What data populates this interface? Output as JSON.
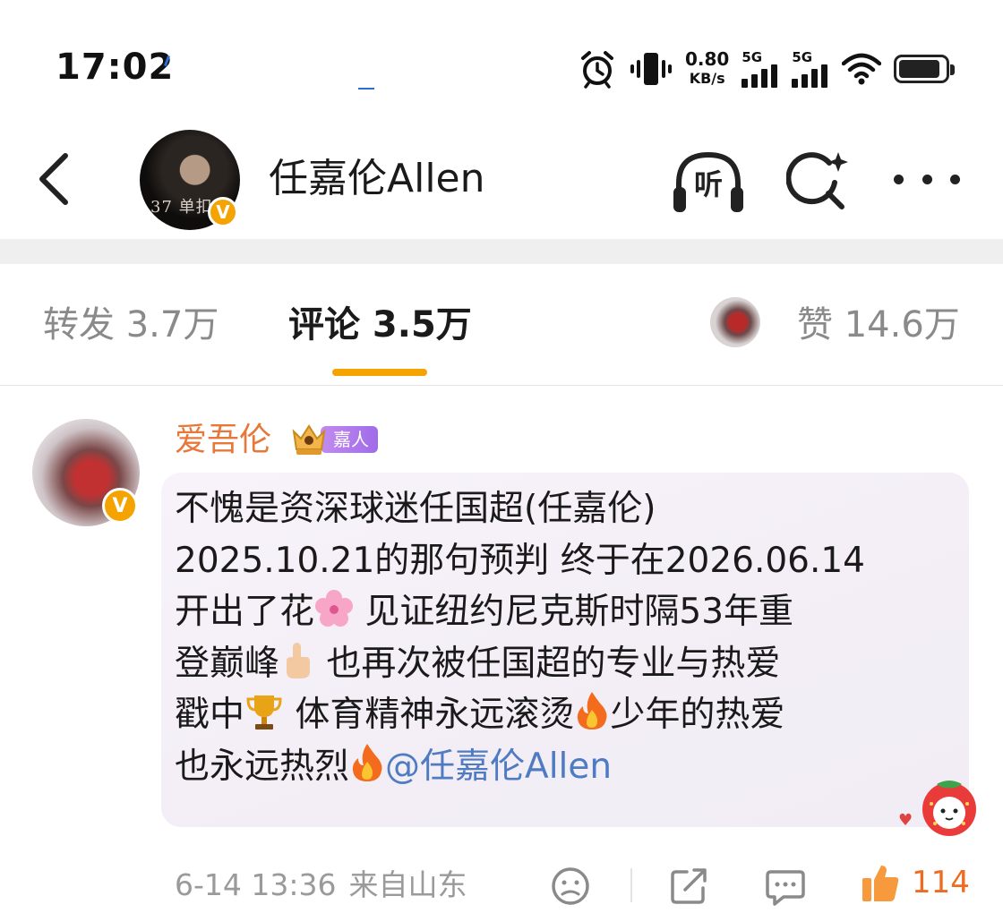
{
  "status_bar": {
    "time": "17:02",
    "network_speed_value": "0.80",
    "network_speed_unit": "KB/s",
    "signal_1_label": "5G",
    "signal_2_label": "5G",
    "battery_level": 0.9
  },
  "header": {
    "title": "任嘉伦Allen",
    "avatar_text": "37 单扣",
    "listen_label": "听"
  },
  "tabs": {
    "repost": "转发 3.7万",
    "comments": "评论 3.5万",
    "likes": "赞 14.6万"
  },
  "comment": {
    "username": "爱吾伦",
    "fan_badge": "嘉人",
    "line1": "不愧是资深球迷任国超(任嘉伦)",
    "line2": "2025.10.21的那句预判 终于在2026.06.14",
    "line3_a": "开出了花",
    "line3_b": " 见证纽约尼克斯时隔53年重",
    "line4_a": "登巅峰",
    "line4_b": " 也再次被任国超的专业与热爱",
    "line5_a": "戳中",
    "line5_b": " 体育精神永远滚烫",
    "line5_c": "少年的热爱",
    "line6_a": "也永远热烈",
    "mention": "@任嘉伦Allen",
    "timestamp": "6-14 13:36",
    "location": "来自山东",
    "like_count": "114"
  },
  "colors": {
    "accent_orange": "#f5a300",
    "username_orange": "#e8773a",
    "mention_blue": "#4f7bc2",
    "like_orange": "#ef6b1f"
  },
  "icons": {
    "back": "chevron-left-icon",
    "listen": "headphones-icon",
    "search": "search-sparkle-icon",
    "more": "more-dots-icon",
    "emoji_react": "neutral-face-icon",
    "share": "share-icon",
    "reply": "comment-icon",
    "like": "thumbs-up-icon"
  }
}
